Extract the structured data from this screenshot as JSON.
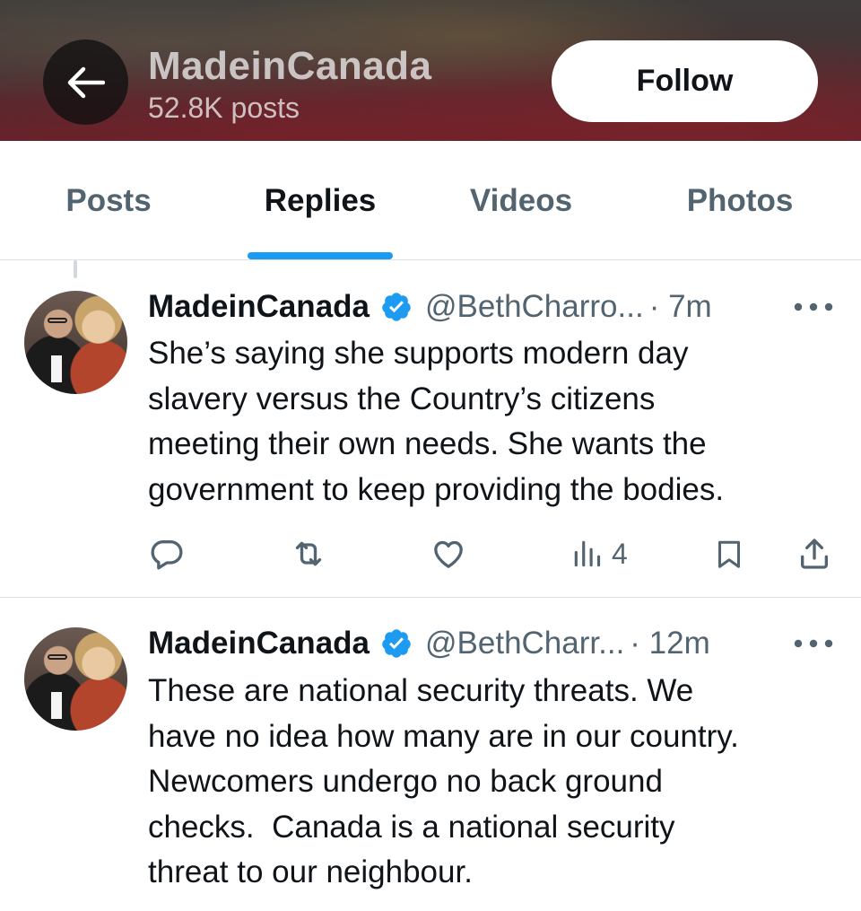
{
  "header": {
    "name": "MadeinCanada",
    "posts_count": "52.8K posts",
    "follow_label": "Follow"
  },
  "tabs": [
    {
      "label": "Posts",
      "active": false
    },
    {
      "label": "Replies",
      "active": true
    },
    {
      "label": "Videos",
      "active": false
    },
    {
      "label": "Photos",
      "active": false
    }
  ],
  "tweets": [
    {
      "author_name": "MadeinCanada",
      "handle": "@BethCharro...",
      "time": "· 7m",
      "lines": [
        "She’s saying she supports modern day",
        "slavery versus the Country’s citizens",
        "meeting their own needs. She wants the",
        "government to keep providing the bodies."
      ],
      "views": "4"
    },
    {
      "author_name": "MadeinCanada",
      "handle": "@BethCharr...",
      "time": "· 12m",
      "lines": [
        "These are national security threats. We",
        "have no idea how many are in our country.",
        "Newcomers undergo no back ground",
        "checks.  Canada is a national security",
        "threat to our neighbour."
      ]
    }
  ],
  "icons": {
    "back": "arrow-left-icon",
    "verified": "verified-badge-icon",
    "more": "more-horizontal-icon",
    "reply": "reply-icon",
    "repost": "repost-icon",
    "like": "like-icon",
    "views": "views-icon",
    "bookmark": "bookmark-icon",
    "share": "share-icon"
  },
  "colors": {
    "accent": "#1d9bf0",
    "text_primary": "#0f1419",
    "text_secondary": "#536471",
    "divider": "#dde1e5"
  }
}
